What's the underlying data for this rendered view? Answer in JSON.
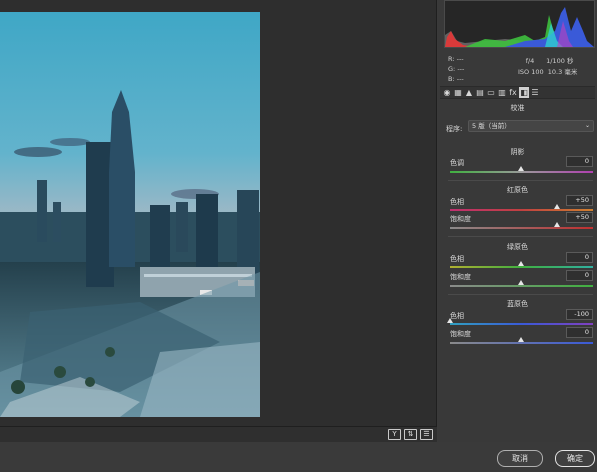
{
  "readout": {
    "r_label": "R:",
    "r_value": "---",
    "g_label": "G:",
    "g_value": "---",
    "b_label": "B:",
    "b_value": "---",
    "aperture": "f/4",
    "shutter": "1/100 秒",
    "iso": "ISO 100",
    "focal": "10.3 毫米"
  },
  "panel": {
    "section_title": "校准",
    "process_label": "程序:",
    "process_value": "5 版（当前）",
    "shadows": {
      "title": "阴影",
      "tint_label": "色调",
      "tint_value": "0",
      "tint_level": 0
    },
    "red": {
      "title": "红原色",
      "hue_label": "色相",
      "hue_value": "+50",
      "hue_level": 50,
      "sat_label": "饱和度",
      "sat_value": "+50",
      "sat_level": 50
    },
    "green": {
      "title": "绿原色",
      "hue_label": "色相",
      "hue_value": "0",
      "hue_level": 0,
      "sat_label": "饱和度",
      "sat_value": "0",
      "sat_level": 0
    },
    "blue": {
      "title": "蓝原色",
      "hue_label": "色相",
      "hue_value": "-100",
      "hue_level": -100,
      "sat_label": "饱和度",
      "sat_value": "0",
      "sat_level": 0
    }
  },
  "tabs": [
    "basic-icon",
    "tone-curve-icon",
    "detail-icon",
    "hsl-icon",
    "split-toning-icon",
    "lens-icon",
    "fx",
    "camera-calibration-icon",
    "presets-icon"
  ],
  "strip_icons": [
    "Y",
    "⇅",
    "☰"
  ],
  "footer": {
    "cancel_label": "取消",
    "ok_label": "确定"
  },
  "colors": {
    "accent_red": "#d04040",
    "accent_green": "#40c040",
    "accent_blue": "#3a5ad8"
  }
}
